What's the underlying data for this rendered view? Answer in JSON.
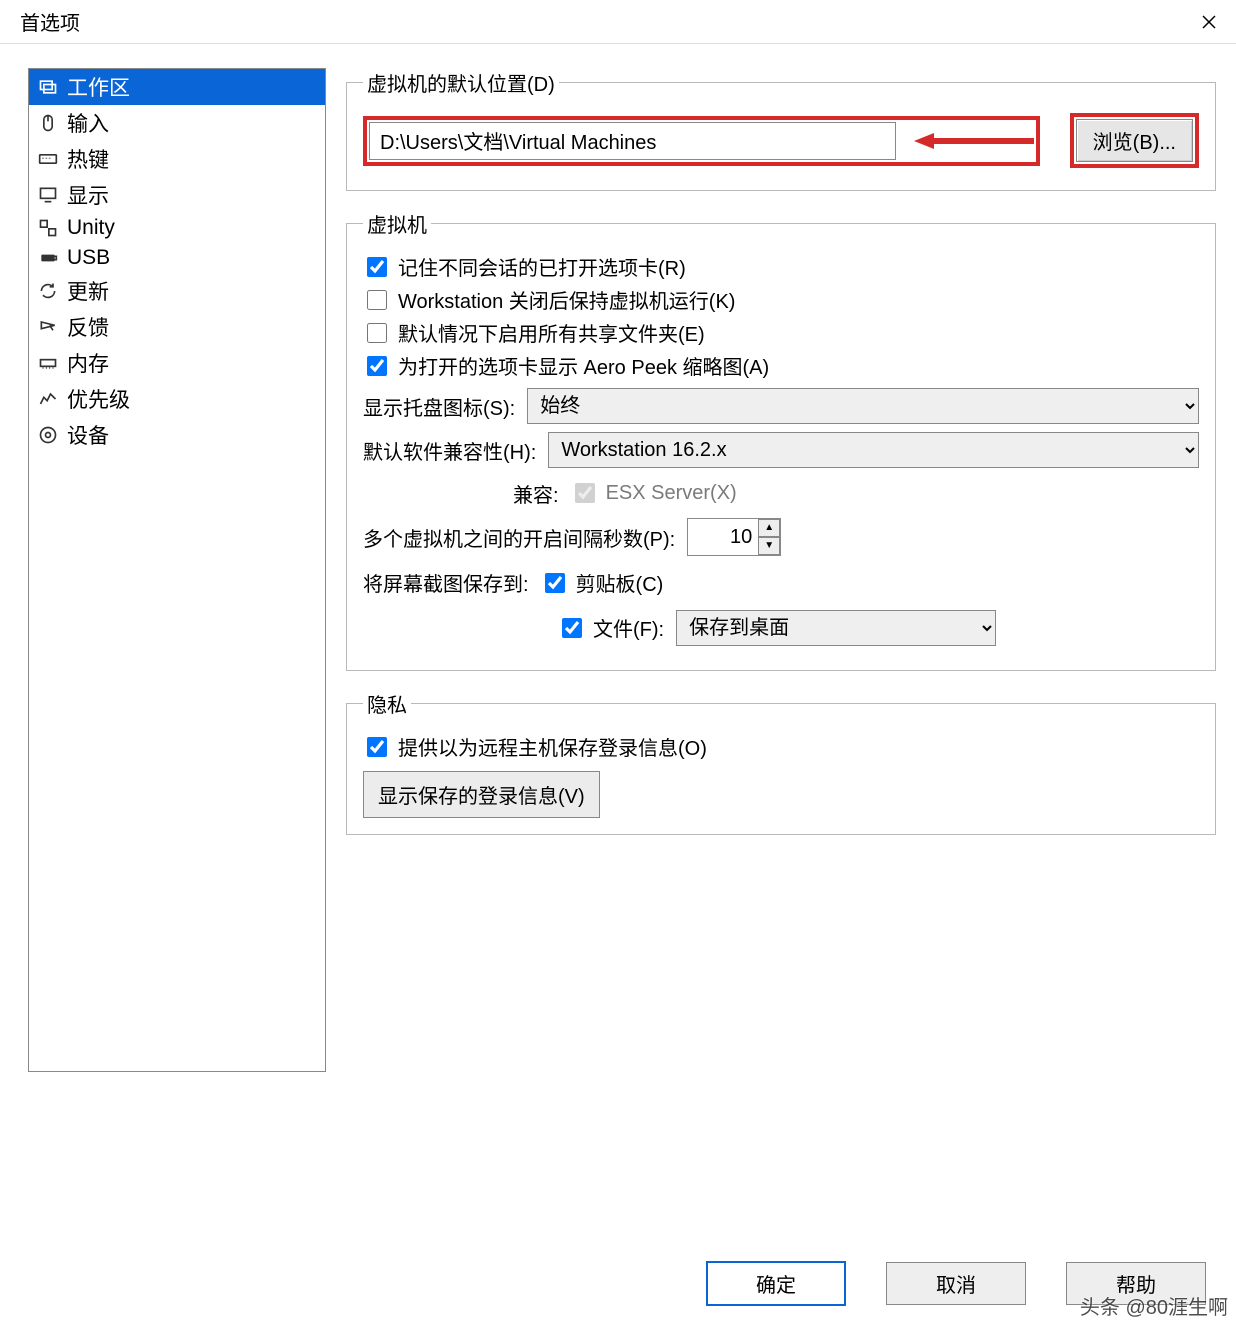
{
  "title": "首选项",
  "sidebar": {
    "items": [
      {
        "label": "工作区",
        "icon": "workspace-icon"
      },
      {
        "label": "输入",
        "icon": "mouse-icon"
      },
      {
        "label": "热键",
        "icon": "keyboard-icon"
      },
      {
        "label": "显示",
        "icon": "display-icon"
      },
      {
        "label": "Unity",
        "icon": "unity-icon"
      },
      {
        "label": "USB",
        "icon": "usb-icon"
      },
      {
        "label": "更新",
        "icon": "update-icon"
      },
      {
        "label": "反馈",
        "icon": "feedback-icon"
      },
      {
        "label": "内存",
        "icon": "memory-icon"
      },
      {
        "label": "优先级",
        "icon": "priority-icon"
      },
      {
        "label": "设备",
        "icon": "device-icon"
      }
    ]
  },
  "default_location": {
    "legend": "虚拟机的默认位置(D)",
    "path": "D:\\Users\\文档\\Virtual Machines",
    "browse_label": "浏览(B)..."
  },
  "vm": {
    "legend": "虚拟机",
    "cb_remember": "记住不同会话的已打开选项卡(R)",
    "cb_keep_running": "Workstation 关闭后保持虚拟机运行(K)",
    "cb_enable_shared": "默认情况下启用所有共享文件夹(E)",
    "cb_aero_peek": "为打开的选项卡显示 Aero Peek 缩略图(A)",
    "tray_label": "显示托盘图标(S):",
    "tray_value": "始终",
    "compat_label": "默认软件兼容性(H):",
    "compat_value": "Workstation 16.2.x",
    "compat_with_label": "兼容:",
    "compat_with_value": "ESX Server(X)",
    "power_interval_label": "多个虚拟机之间的开启间隔秒数(P):",
    "power_interval_value": "10",
    "screenshot_label": "将屏幕截图保存到:",
    "screenshot_clipboard": "剪贴板(C)",
    "screenshot_file": "文件(F):",
    "screenshot_file_value": "保存到桌面"
  },
  "privacy": {
    "legend": "隐私",
    "cb_save_login": "提供以为远程主机保存登录信息(O)",
    "show_login_btn": "显示保存的登录信息(V)"
  },
  "footer": {
    "ok": "确定",
    "cancel": "取消",
    "help": "帮助"
  },
  "watermark": "头条 @80涯生啊"
}
